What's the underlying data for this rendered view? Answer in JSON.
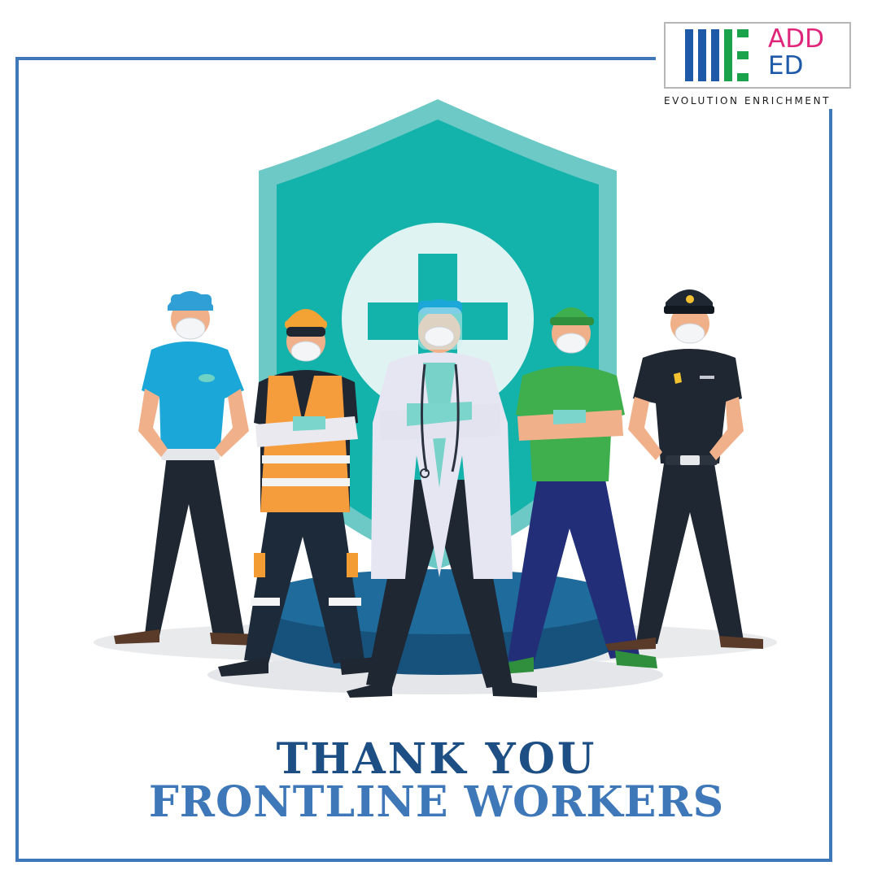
{
  "logo": {
    "line1": "ADD",
    "line2": "ED",
    "tagline": "EVOLUTION ENRICHMENT",
    "icon": "added-logo-icon",
    "colors": {
      "magenta": "#e0267a",
      "blue": "#1e5aa8",
      "green": "#1aa34a"
    }
  },
  "headline": {
    "line1": "THANK YOU",
    "line2": "FRONTLINE WORKERS"
  },
  "illustration": {
    "shield_icon": "shield-icon",
    "cross_icon": "medical-cross-icon",
    "workers": [
      "sanitation-worker",
      "road-worker",
      "doctor",
      "delivery-worker",
      "police-officer"
    ],
    "colors": {
      "shield": "#13b3ac",
      "frame": "#3f78b9"
    }
  }
}
